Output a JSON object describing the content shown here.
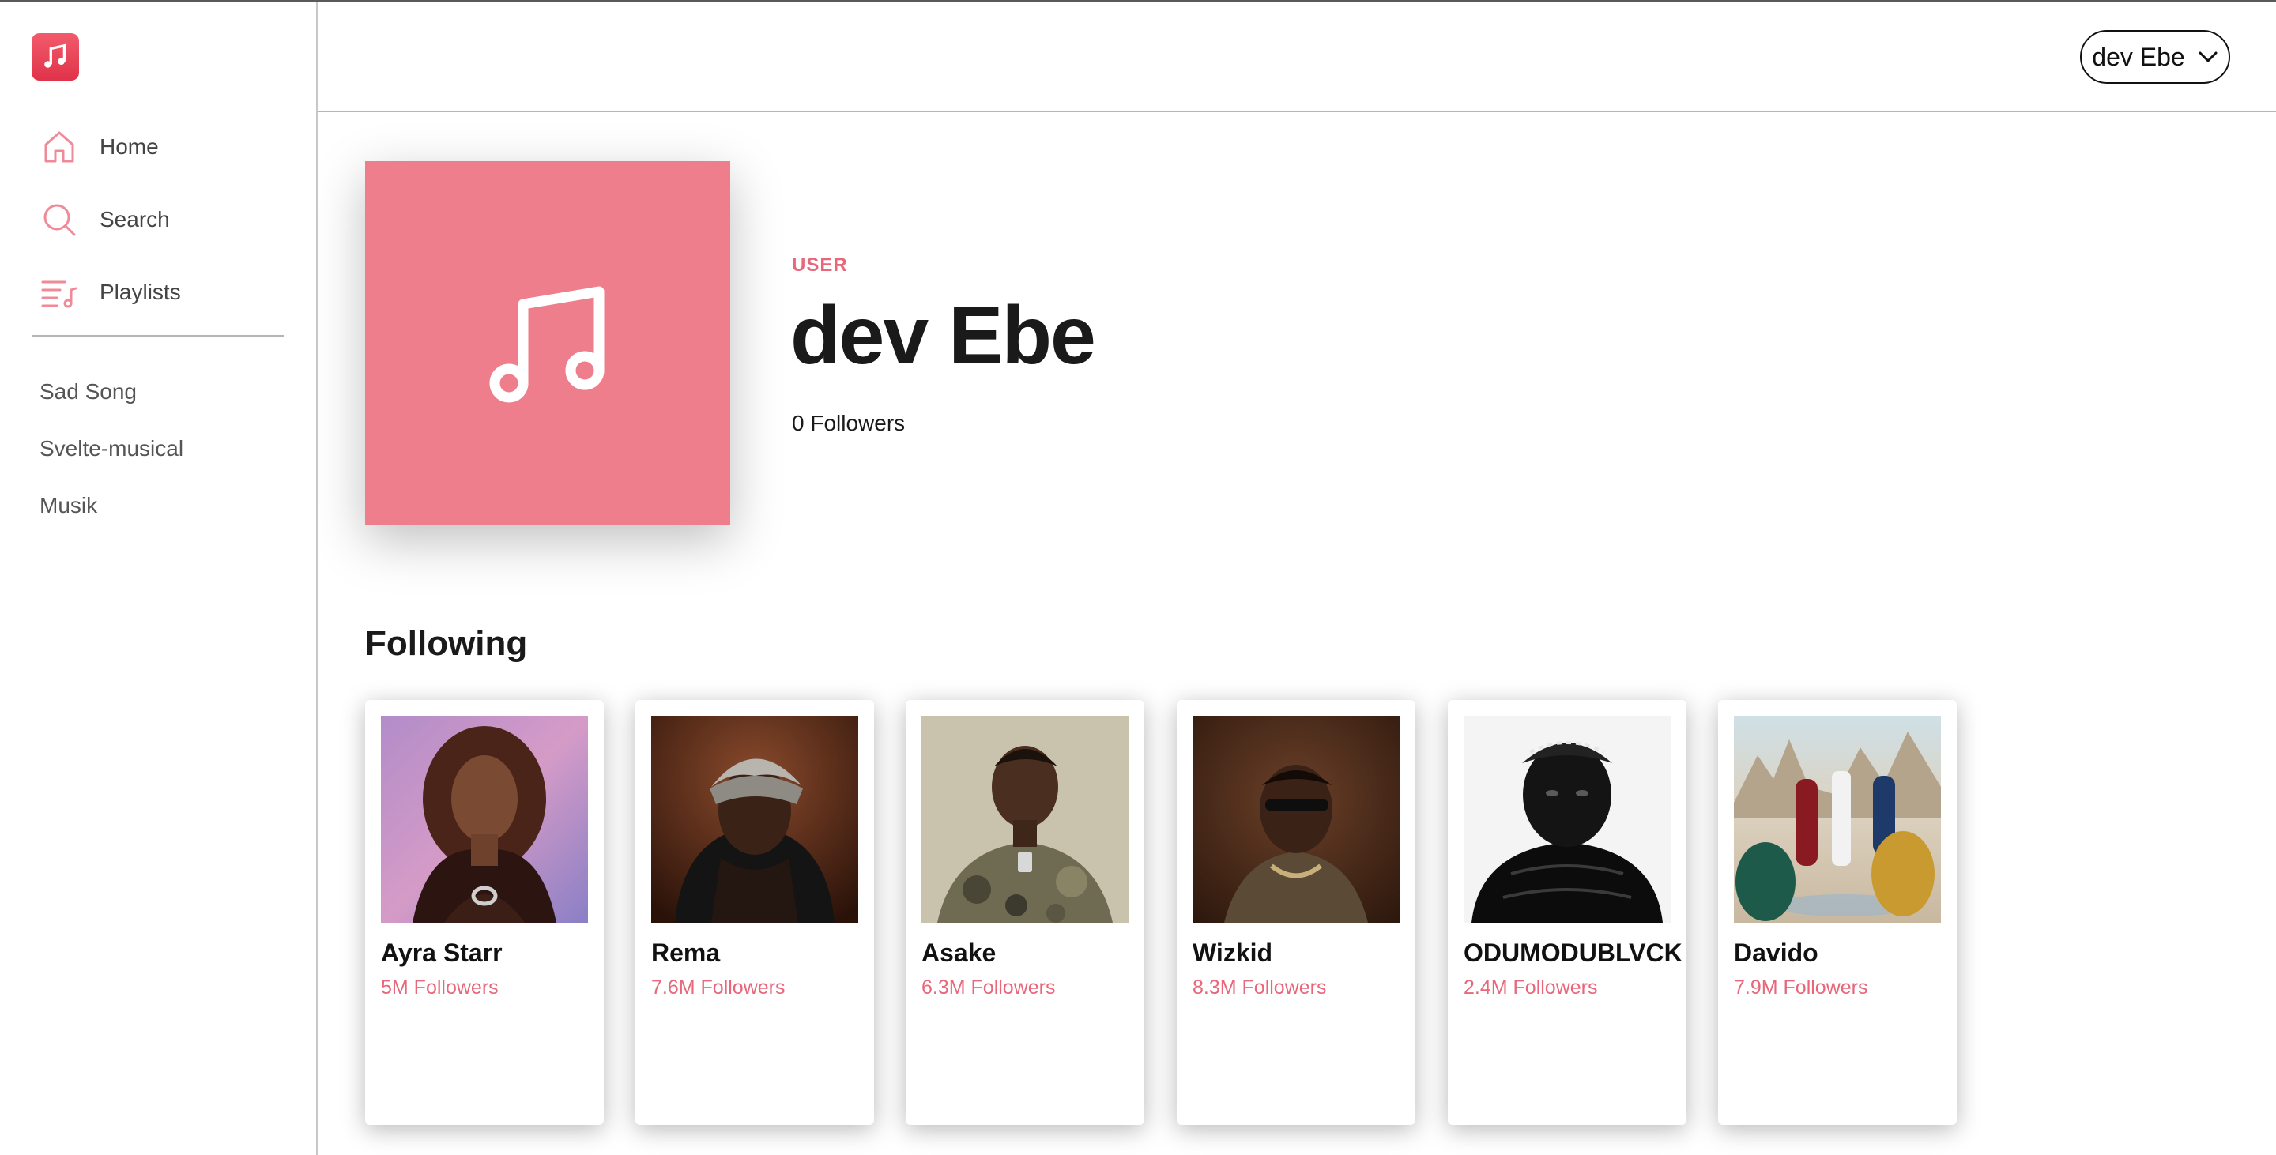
{
  "app": {
    "logo_icon": "music-note-icon",
    "accent": "#e8677a"
  },
  "sidebar": {
    "nav": [
      {
        "label": "Home",
        "icon": "home-icon"
      },
      {
        "label": "Search",
        "icon": "search-icon"
      },
      {
        "label": "Playlists",
        "icon": "playlist-icon"
      }
    ],
    "playlists": [
      "Sad Song",
      "Svelte-musical",
      "Musik"
    ]
  },
  "header": {
    "user_name": "dev Ebe",
    "menu_icon": "chevron-down-icon"
  },
  "profile": {
    "kind": "USER",
    "name": "dev Ebe",
    "followers": "0 Followers",
    "cover_icon": "music-note-icon",
    "cover_color": "#ef7e8d"
  },
  "following": {
    "title": "Following",
    "artists": [
      {
        "name": "Ayra Starr",
        "followers": "5M Followers"
      },
      {
        "name": "Rema",
        "followers": "7.6M Followers"
      },
      {
        "name": "Asake",
        "followers": "6.3M Followers"
      },
      {
        "name": "Wizkid",
        "followers": "8.3M Followers"
      },
      {
        "name": "ODUMODUBLVCK",
        "followers": "2.4M Followers"
      },
      {
        "name": "Davido",
        "followers": "7.9M Followers"
      }
    ]
  }
}
